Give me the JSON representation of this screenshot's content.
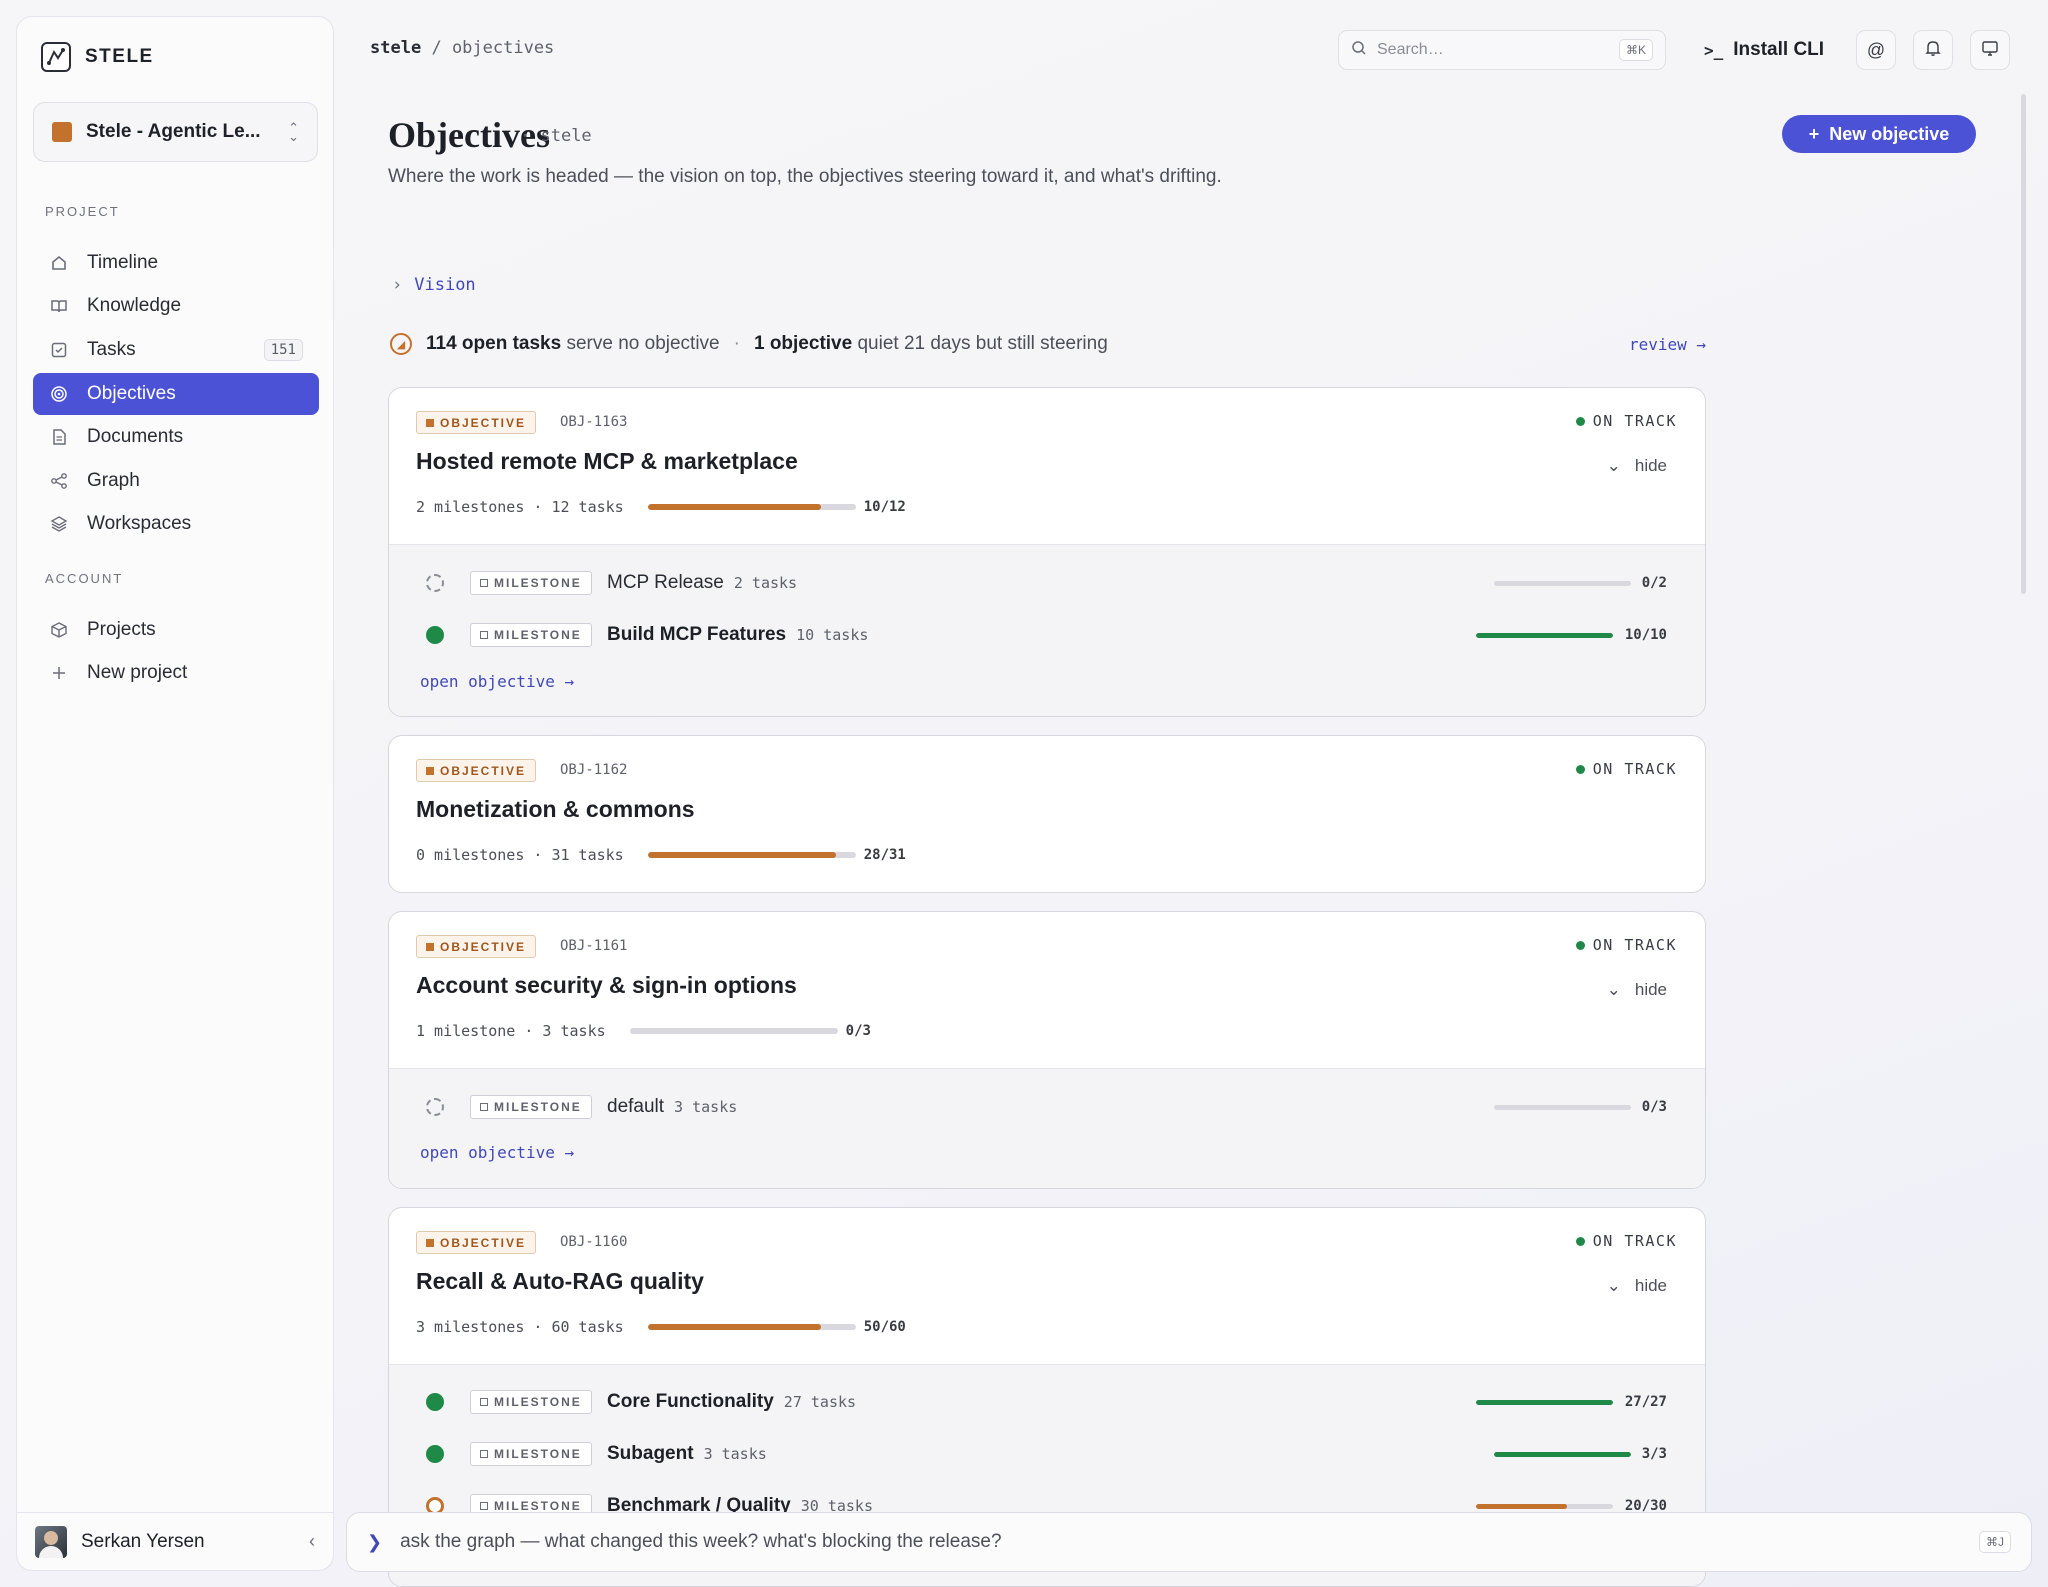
{
  "brand": {
    "name": "STELE"
  },
  "workspace": {
    "name": "Stele - Agentic Le...",
    "color": "#c2722c"
  },
  "nav": {
    "project_section": "PROJECT",
    "items": [
      {
        "label": "Timeline",
        "icon": "home-icon"
      },
      {
        "label": "Knowledge",
        "icon": "book-icon"
      },
      {
        "label": "Tasks",
        "icon": "checkbox-icon",
        "badge": "151"
      },
      {
        "label": "Objectives",
        "icon": "target-icon",
        "active": true
      },
      {
        "label": "Documents",
        "icon": "document-icon"
      },
      {
        "label": "Graph",
        "icon": "share-graph-icon"
      },
      {
        "label": "Workspaces",
        "icon": "layers-icon"
      }
    ],
    "account_section": "ACCOUNT",
    "account_items": [
      {
        "label": "Projects",
        "icon": "cube-icon"
      },
      {
        "label": "New project",
        "icon": "plus-icon"
      }
    ]
  },
  "user": {
    "name": "Serkan Yersen"
  },
  "breadcrumb": {
    "root": "stele",
    "separator": "/",
    "current": "objectives"
  },
  "search": {
    "placeholder": "Search…",
    "shortcut": "⌘K"
  },
  "toolbar": {
    "install_cli": "Install CLI",
    "install_cli_prompt": ">_"
  },
  "page": {
    "title": "Objectives",
    "project": "stele",
    "description": "Where the work is headed — the vision on top, the objectives steering toward it, and what's drifting.",
    "new_button": "New objective"
  },
  "vision": {
    "label": "Vision"
  },
  "drift": {
    "open_tasks": "114 open tasks",
    "open_tasks_rest": "serve no objective",
    "quiet": "1 objective",
    "quiet_rest": "quiet 21 days but still steering",
    "review": "review →"
  },
  "labels": {
    "objective_tag": "OBJECTIVE",
    "milestone_tag": "MILESTONE",
    "hide": "hide",
    "open_objective": "open objective →"
  },
  "objectives": [
    {
      "id": "OBJ-1163",
      "title": "Hosted remote MCP & marketplace",
      "status": "ON TRACK",
      "meta": "2 milestones · 12 tasks",
      "count": "10/12",
      "progress": 0.833,
      "milestones": [
        {
          "name": "MCP Release",
          "tasks": "2 tasks",
          "count": "0/2",
          "progress": 0,
          "state": "todo"
        },
        {
          "name": "Build MCP Features",
          "tasks": "10 tasks",
          "count": "10/10",
          "progress": 1,
          "state": "done"
        }
      ]
    },
    {
      "id": "OBJ-1162",
      "title": "Monetization & commons",
      "status": "ON TRACK",
      "meta": "0 milestones · 31 tasks",
      "count": "28/31",
      "progress": 0.903,
      "milestones": []
    },
    {
      "id": "OBJ-1161",
      "title": "Account security & sign-in options",
      "status": "ON TRACK",
      "meta": "1 milestone · 3 tasks",
      "count": "0/3",
      "progress": 0,
      "milestones": [
        {
          "name": "default",
          "tasks": "3 tasks",
          "count": "0/3",
          "progress": 0,
          "state": "todo"
        }
      ]
    },
    {
      "id": "OBJ-1160",
      "title": "Recall & Auto-RAG quality",
      "status": "ON TRACK",
      "meta": "3 milestones · 60 tasks",
      "count": "50/60",
      "progress": 0.833,
      "milestones": [
        {
          "name": "Core Functionality",
          "tasks": "27 tasks",
          "count": "27/27",
          "progress": 1,
          "state": "done"
        },
        {
          "name": "Subagent",
          "tasks": "3 tasks",
          "count": "3/3",
          "progress": 1,
          "state": "done"
        },
        {
          "name": "Benchmark / Quality",
          "tasks": "30 tasks",
          "count": "20/30",
          "progress": 0.667,
          "state": "prog"
        }
      ]
    }
  ],
  "ask": {
    "placeholder": "ask the graph — what changed this week? what's blocking the release?",
    "shortcut": "⌘J"
  },
  "colors": {
    "accent": "#4b52d6",
    "brand_orange": "#c2722c",
    "success": "#1f8a47"
  }
}
